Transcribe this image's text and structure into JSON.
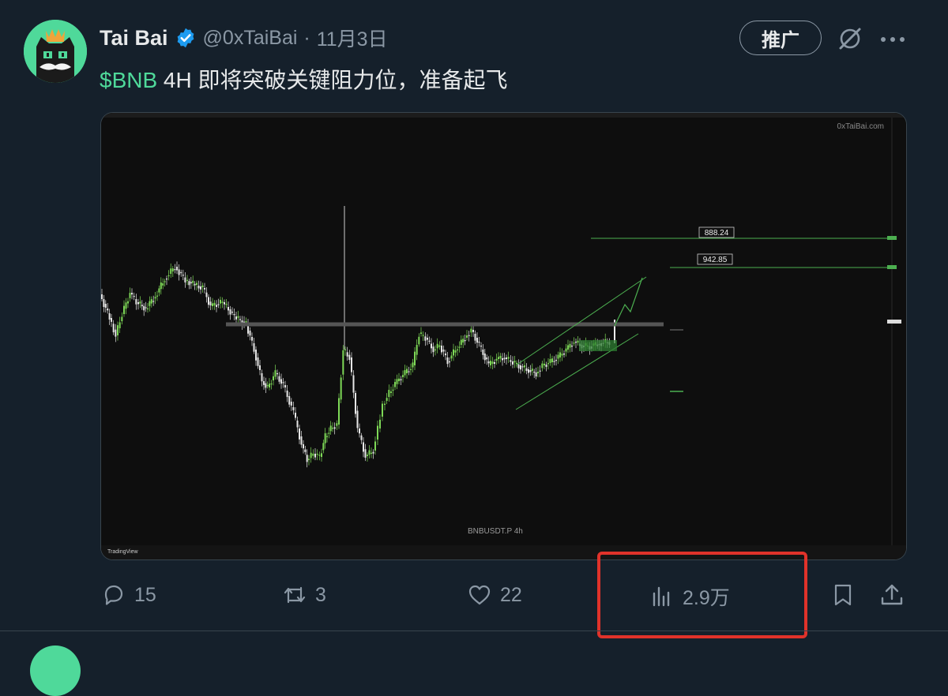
{
  "tweet": {
    "display_name": "Tai Bai",
    "handle": "@0xTaiBai",
    "separator": "·",
    "time": "11月3日",
    "text_cashtag": "$BNB",
    "text_rest": " 4H  即将突破关键阻力位，准备起飞",
    "promote_label": "推广"
  },
  "media": {
    "watermark": "0xTaiBai.com",
    "symbol": "BNBUSDT.P   4h",
    "brand": "TradingView",
    "price_label_upper": "888.24",
    "price_label_lower": "942.85"
  },
  "actions": {
    "replies": "15",
    "retweets": "3",
    "likes": "22",
    "views": "2.9万"
  },
  "colors": {
    "accent": "#4fd99a",
    "verified": "#1d9bf0",
    "highlight": "#e0322a"
  },
  "icons": [
    "avatar",
    "verified-badge-icon",
    "grok-icon",
    "more-icon",
    "reply-icon",
    "retweet-icon",
    "like-icon",
    "views-icon",
    "bookmark-icon",
    "share-icon"
  ]
}
